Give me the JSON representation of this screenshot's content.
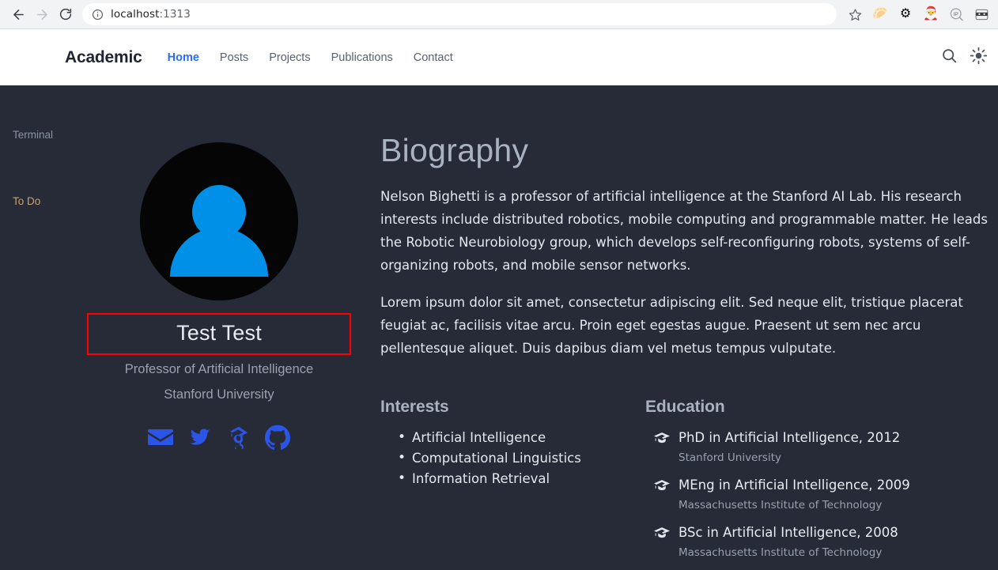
{
  "browser": {
    "back_label": "Back",
    "forward_label": "Forward",
    "reload_label": "Reload",
    "site_info_label": "Site information",
    "url_host": "localhost",
    "url_port": ":1313",
    "bookmark_label": "Bookmark this tab",
    "extensions": [
      {
        "name": "extension-icon-orange-bird",
        "glyph": "🥟"
      },
      {
        "name": "extension-icon-gear",
        "glyph": "⚙"
      },
      {
        "name": "extension-icon-santa-hat",
        "glyph": "🎅"
      },
      {
        "name": "extension-icon-ip-lookup",
        "glyph": "IP"
      },
      {
        "name": "extension-icon-masked-face",
        "glyph": "🥽"
      }
    ]
  },
  "desktop": {
    "terminal_label": "Terminal",
    "todo_label": "To Do"
  },
  "site_nav": {
    "brand": "Academic",
    "links": [
      {
        "label": "Home",
        "active": true
      },
      {
        "label": "Posts",
        "active": false
      },
      {
        "label": "Projects",
        "active": false
      },
      {
        "label": "Publications",
        "active": false
      },
      {
        "label": "Contact",
        "active": false
      }
    ],
    "search_label": "Search",
    "theme_toggle_label": "Toggle light/dark mode"
  },
  "profile": {
    "avatar_alt": "Default user avatar",
    "name": "Test Test",
    "role": "Professor of Artificial Intelligence",
    "organization": "Stanford University",
    "socials": [
      {
        "name": "email-icon",
        "label": "Email"
      },
      {
        "name": "twitter-icon",
        "label": "Twitter"
      },
      {
        "name": "google-scholar-icon",
        "label": "Google Scholar"
      },
      {
        "name": "github-icon",
        "label": "GitHub"
      }
    ]
  },
  "biography": {
    "title": "Biography",
    "paragraph1": "Nelson Bighetti is a professor of artificial intelligence at the Stanford AI Lab. His research interests include distributed robotics, mobile computing and programmable matter. He leads the Robotic Neurobiology group, which develops self-reconfiguring robots, systems of self-organizing robots, and mobile sensor networks.",
    "paragraph2": "Lorem ipsum dolor sit amet, consectetur adipiscing elit. Sed neque elit, tristique placerat feugiat ac, facilisis vitae arcu. Proin eget egestas augue. Praesent ut sem nec arcu pellentesque aliquet. Duis dapibus diam vel metus tempus vulputate."
  },
  "interests": {
    "title": "Interests",
    "items": [
      "Artificial Intelligence",
      "Computational Linguistics",
      "Information Retrieval"
    ]
  },
  "education": {
    "title": "Education",
    "items": [
      {
        "course": "PhD in Artificial Intelligence, 2012",
        "institution": "Stanford University"
      },
      {
        "course": "MEng in Artificial Intelligence, 2009",
        "institution": "Massachusetts Institute of Technology"
      },
      {
        "course": "BSc in Artificial Intelligence, 2008",
        "institution": "Massachusetts Institute of Technology"
      }
    ]
  },
  "colors": {
    "page_background": "#272b38",
    "navbar_background": "#ffffff",
    "accent_link": "#2b6cf6",
    "avatar_person": "#0090e8",
    "social_icon": "#2b55e8",
    "highlight_outline": "#ff0000",
    "heading_muted": "#a9b2c0"
  }
}
